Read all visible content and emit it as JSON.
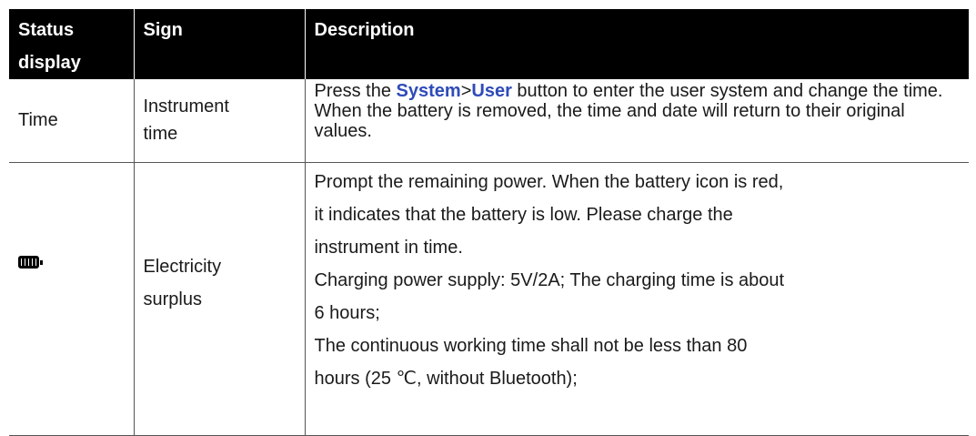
{
  "headers": {
    "status_line1": "Status",
    "status_line2": "display",
    "sign": "Sign",
    "description": "Description"
  },
  "rows": [
    {
      "status": "Time",
      "sign_line1": "Instrument",
      "sign_line2": "time",
      "desc_pre": "Press the ",
      "desc_kw1": "System",
      "desc_sep": ">",
      "desc_kw2": "User",
      "desc_post": " button to enter the user system and change the time. When the battery is removed, the time and date will return to their original values."
    },
    {
      "status_icon": "battery-full-icon",
      "sign_line1": "Electricity",
      "sign_line2": "surplus",
      "desc_lines": [
        "Prompt the remaining power. When the battery icon is red,",
        "it indicates that the battery is low. Please charge the",
        "instrument in time.",
        "Charging power supply: 5V/2A; The charging time is about",
        "6 hours;",
        "The continuous working time shall not be less than 80",
        "hours (25 ℃, without Bluetooth);"
      ]
    }
  ],
  "colors": {
    "header_bg": "#000000",
    "keyword": "#2e4bb8"
  }
}
